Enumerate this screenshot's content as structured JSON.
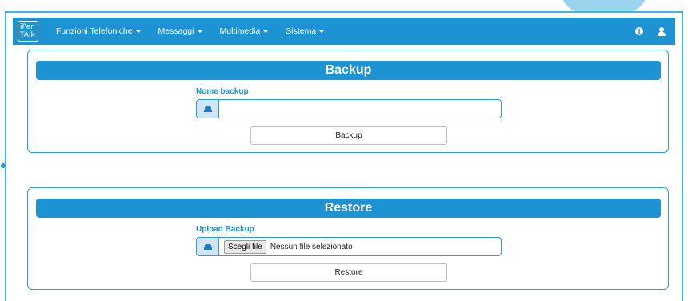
{
  "navbar": {
    "logo_line1": "iPer",
    "logo_line2": "TAlk",
    "menus": [
      {
        "label": "Funzioni Telefoniche"
      },
      {
        "label": "Messaggi"
      },
      {
        "label": "Multimedia"
      },
      {
        "label": "Sistema"
      }
    ],
    "icons": [
      "info-icon",
      "user-icon"
    ]
  },
  "backup": {
    "title": "Backup",
    "field_label": "Nome backup",
    "input_value": "",
    "icon": "hdd-icon",
    "button_label": "Backup"
  },
  "restore": {
    "title": "Restore",
    "field_label": "Upload Backup",
    "icon": "hdd-icon",
    "file_button_label": "Scegli file",
    "file_status": "Nessun file selezionato",
    "button_label": "Restore"
  },
  "colors": {
    "accent": "#1d93d3",
    "frame": "#3fb6e6",
    "addon": "#cfe6f6"
  }
}
